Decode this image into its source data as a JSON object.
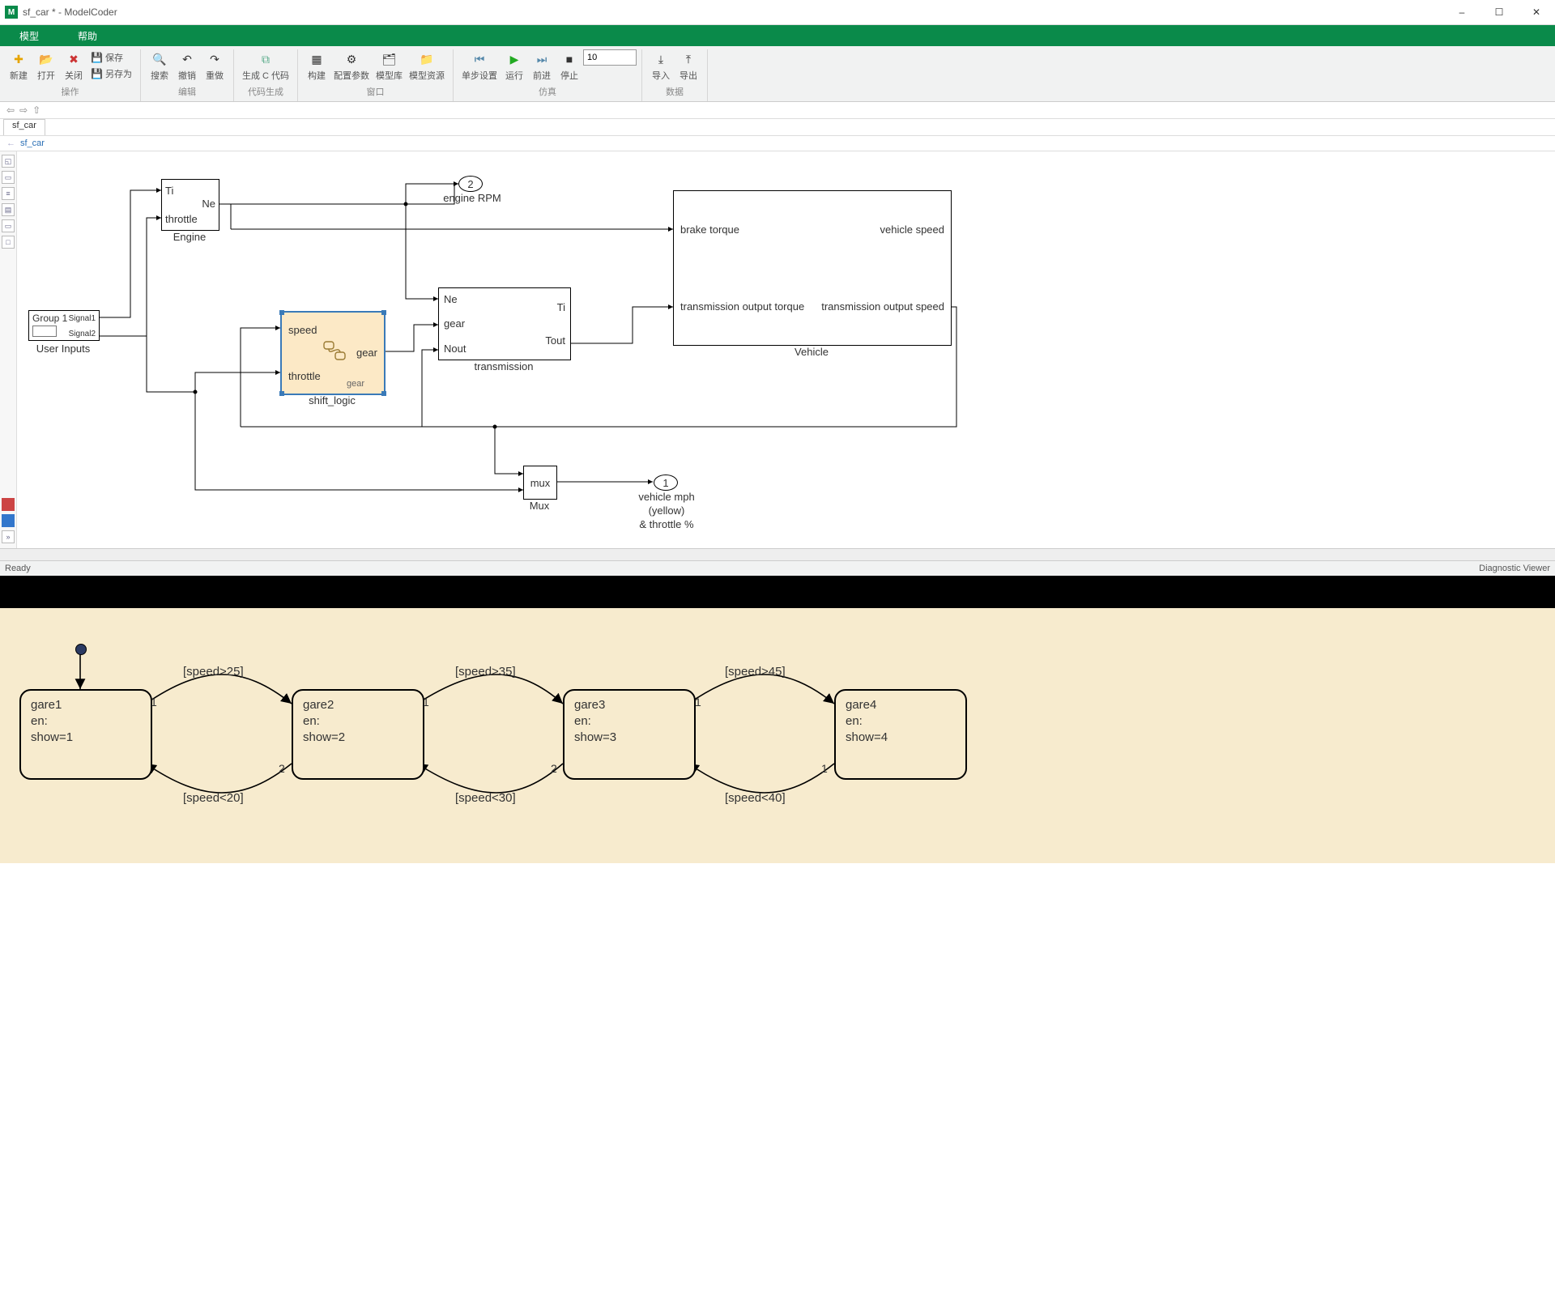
{
  "window": {
    "title": "sf_car * - ModelCoder"
  },
  "menus": {
    "model": "模型",
    "help": "帮助"
  },
  "ribbon": {
    "groups": {
      "operate": {
        "label": "操作",
        "new": "新建",
        "open": "打开",
        "close": "关闭",
        "save": "保存",
        "saveas": "另存为"
      },
      "edit": {
        "label": "编辑",
        "search": "搜索",
        "undo": "撤销",
        "redo": "重做"
      },
      "codegen": {
        "label": "代码生成",
        "gen": "生成 C 代码"
      },
      "windows": {
        "label": "窗口",
        "build": "构建",
        "cfg": "配置参数",
        "mdl": "模型库",
        "res": "模型资源"
      },
      "sim": {
        "label": "仿真",
        "step": "单步设置",
        "run": "运行",
        "fwd": "前进",
        "stop": "停止",
        "time": "10"
      },
      "data": {
        "label": "数据",
        "imp": "导入",
        "exp": "导出"
      }
    }
  },
  "tabs": {
    "active": "sf_car"
  },
  "crumb": "sf_car",
  "status": {
    "left": "Ready",
    "right": "Diagnostic Viewer"
  },
  "blocks": {
    "userInputs": {
      "name": "User Inputs",
      "title": "Group 1",
      "sig1": "Signal1",
      "sig2": "Signal2"
    },
    "engine": {
      "name": "Engine",
      "in1": "Ti",
      "in2": "throttle",
      "out": "Ne"
    },
    "shiftLogic": {
      "name": "shift_logic",
      "in1": "speed",
      "in2": "throttle",
      "out": "gear",
      "inner": "gear"
    },
    "trans": {
      "name": "transmission",
      "in1": "Ne",
      "in2": "gear",
      "in3": "Nout",
      "out1": "Ti",
      "out2": "Tout"
    },
    "vehicle": {
      "name": "Vehicle",
      "in1": "brake torque",
      "in2": "transmission output torque",
      "out1": "vehicle speed",
      "out2": "transmission output speed"
    },
    "mux": {
      "name": "Mux",
      "label": "mux"
    },
    "out1": {
      "num": "2",
      "label": "engine RPM"
    },
    "out2": {
      "num": "1",
      "l1": "vehicle mph",
      "l2": "(yellow)",
      "l3": "& throttle %"
    }
  },
  "statechart": {
    "states": [
      {
        "name": "gare1",
        "body": "en:\nshow=1"
      },
      {
        "name": "gare2",
        "body": "en:\nshow=2"
      },
      {
        "name": "gare3",
        "body": "en:\nshow=3"
      },
      {
        "name": "gare4",
        "body": "en:\nshow=4"
      }
    ],
    "transitions": {
      "f12": "[speed>25]",
      "f23": "[speed>35]",
      "f34": "[speed>45]",
      "b21": "[speed<20]",
      "b32": "[speed<30]",
      "b43": "[speed<40]"
    }
  }
}
